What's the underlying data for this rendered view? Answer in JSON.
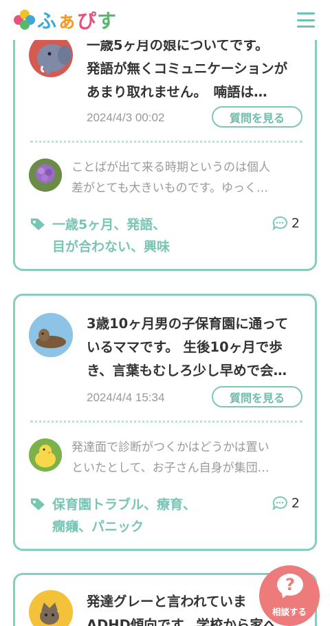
{
  "header": {
    "logo_text_parts": [
      "ふ",
      "ぁ",
      "ぴ",
      "す"
    ],
    "menu_icon": "hamburger-menu-icon"
  },
  "cards": [
    {
      "question_lines": [
        "一歳5ヶ月の娘についてです。",
        "発語が無くコミュニケーションが",
        "あまり取れません。　喃語は…"
      ],
      "date": "2024/4/3 00:02",
      "view_button": "質問を見る",
      "answer_lines": [
        "ことばが出て来る時期というのは個人",
        "差がとても大きいものです。ゆっく…"
      ],
      "tag_lines": [
        "一歳5ヶ月、発語、",
        "目が合わない、興味"
      ],
      "comment_count": "2"
    },
    {
      "question_lines": [
        "3歳10ヶ月男の子保育園に通って",
        "いるママです。 生後10ヶ月で歩",
        "き、言葉もむしろ少し早めで会…"
      ],
      "date": "2024/4/4 15:34",
      "view_button": "質問を見る",
      "answer_lines": [
        "発達面で診断がつくかはどうかは置い",
        "といたとして、お子さん自身が集団…"
      ],
      "tag_lines": [
        "保育園トラブル、療育、",
        "癇癪、パニック"
      ],
      "comment_count": "2"
    },
    {
      "question_lines": [
        "発達グレーと言われていま",
        "ADHD傾向です。学校から家へ"
      ]
    }
  ],
  "float_button": {
    "icon_text": "?",
    "label": "相談する"
  },
  "colors": {
    "accent": "#87cdbf",
    "tag": "#78c5b5",
    "float": "#ee7b7b"
  }
}
